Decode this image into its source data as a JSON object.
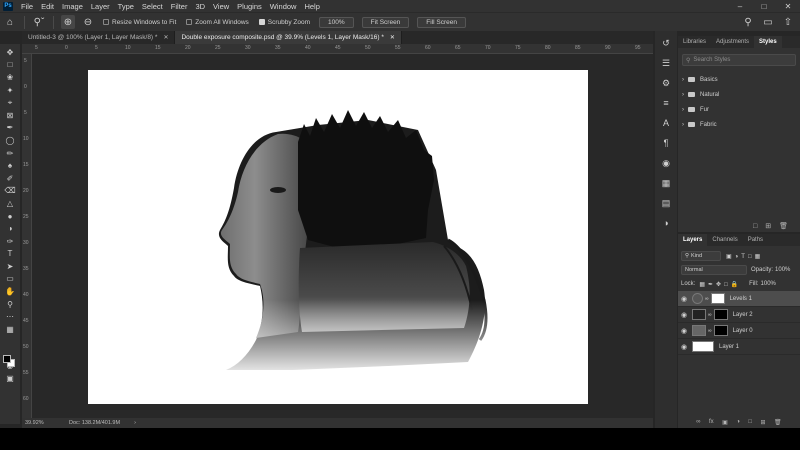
{
  "app": {
    "logo": "Ps",
    "menu": [
      "File",
      "Edit",
      "Image",
      "Layer",
      "Type",
      "Select",
      "Filter",
      "3D",
      "View",
      "Plugins",
      "Window",
      "Help"
    ],
    "window_controls": [
      "minimize-icon",
      "maximize-icon",
      "close-icon"
    ]
  },
  "options_bar": {
    "resize_windows_label": "Resize Windows to Fit",
    "resize_windows_checked": false,
    "zoom_all_label": "Zoom All Windows",
    "zoom_all_checked": false,
    "scrubby_zoom_label": "Scrubby Zoom",
    "scrubby_zoom_checked": true,
    "percent_button": "100%",
    "fit_screen_button": "Fit Screen",
    "fill_screen_button": "Fill Screen"
  },
  "tabs": [
    {
      "label": "Untitled-3 @ 100% (Layer 1, Layer Mask/8) *",
      "active": false
    },
    {
      "label": "Double exposure composite.psd @ 39.9% (Levels 1, Layer Mask/16) *",
      "active": true
    }
  ],
  "rulers": {
    "top": [
      "5",
      "0",
      "5",
      "10",
      "15",
      "20",
      "25",
      "30",
      "35",
      "40",
      "45",
      "50",
      "55",
      "60",
      "65",
      "70",
      "75",
      "80",
      "85",
      "90",
      "95"
    ],
    "left": [
      "5",
      "0",
      "5",
      "10",
      "15",
      "20",
      "25",
      "30",
      "35",
      "40",
      "45",
      "50",
      "55",
      "60"
    ]
  },
  "status": {
    "zoom": "39.92%",
    "doc": "Doc: 138.2M/401.9M"
  },
  "panels": {
    "top_tabs": [
      "Libraries",
      "Adjustments",
      "Styles"
    ],
    "search_placeholder": "Search Styles",
    "style_groups": [
      "Basics",
      "Natural",
      "Fur",
      "Fabric"
    ],
    "layers_tabs": [
      "Layers",
      "Channels",
      "Paths"
    ],
    "kind_label": "Kind",
    "blend_mode": "Normal",
    "opacity_label": "Opacity:",
    "opacity_value": "100%",
    "lock_label": "Lock:",
    "fill_label": "Fill:",
    "fill_value": "100%",
    "layers": [
      {
        "name": "Levels 1",
        "selected": true
      },
      {
        "name": "Layer 2",
        "selected": false
      },
      {
        "name": "Layer 0",
        "selected": false
      },
      {
        "name": "Layer 1",
        "selected": false
      }
    ]
  }
}
